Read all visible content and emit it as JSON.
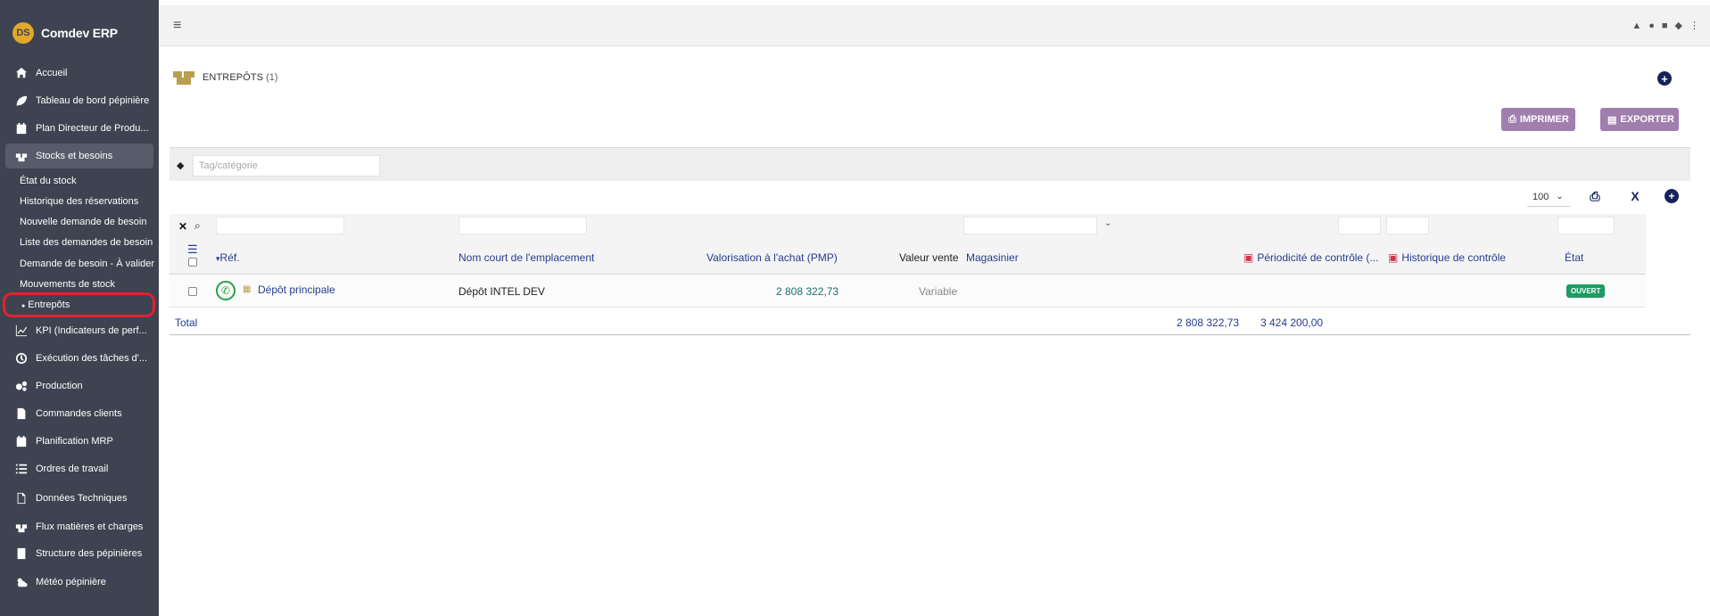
{
  "app": {
    "title": "Comdev ERP",
    "logo_text": "DS"
  },
  "sidebar": {
    "items": [
      {
        "label": "Accueil",
        "icon": "home-icon"
      },
      {
        "label": "Tableau de bord pépinière",
        "icon": "leaf-icon"
      },
      {
        "label": "Plan Directeur de Produ...",
        "icon": "calendar-icon"
      },
      {
        "label": "Stocks et besoins",
        "icon": "boxes-icon"
      },
      {
        "label": "KPI (Indicateurs de perf...",
        "icon": "chart-icon"
      },
      {
        "label": "Exécution des tâches d'...",
        "icon": "clock-icon"
      },
      {
        "label": "Production",
        "icon": "gears-icon"
      },
      {
        "label": "Commandes clients",
        "icon": "document-icon"
      },
      {
        "label": "Planification MRP",
        "icon": "calendar-icon"
      },
      {
        "label": "Ordres de travail",
        "icon": "list-icon"
      },
      {
        "label": "Données Techniques",
        "icon": "document-icon"
      },
      {
        "label": "Flux matières et charges",
        "icon": "boxes-icon"
      },
      {
        "label": "Structure des pépinières",
        "icon": "building-icon"
      },
      {
        "label": "Météo pépinière",
        "icon": "weather-icon"
      }
    ],
    "subitems": [
      "État du stock",
      "Historique des réservations",
      "Nouvelle demande de besoin",
      "Liste des demandes de besoin",
      "Demande de besoin - À valider",
      "Mouvements de stock",
      "Entrepôts"
    ]
  },
  "page": {
    "title": "ENTREPÔTS",
    "count": "(1)",
    "print_label": "IMPRIMER",
    "export_label": "EXPORTER",
    "tag_placeholder": "Tag/catégorie",
    "per_page": "100"
  },
  "table": {
    "headers": {
      "ref": "Réf.",
      "short_name": "Nom court de l'emplacement",
      "valuation": "Valorisation à l'achat (PMP)",
      "sale_value": "Valeur vente",
      "storekeeper": "Magasinier",
      "control_period": "Périodicité de contrôle (...",
      "control_history": "Historique de contrôle",
      "state": "État"
    },
    "rows": [
      {
        "ref": "Dépôt principale",
        "short_name": "Dépôt INTEL DEV",
        "valuation": "2 808 322,73",
        "sale_value": "Variable",
        "state": "OUVERT"
      }
    ],
    "total": {
      "label": "Total",
      "valuation": "2 808 322,73",
      "sale_value": "3 424 200,00"
    }
  },
  "colors": {
    "sidebar_bg": "#3d4350",
    "accent_purple": "#a07eae",
    "link_blue": "#263c8e",
    "status_green": "#1e9b64"
  }
}
